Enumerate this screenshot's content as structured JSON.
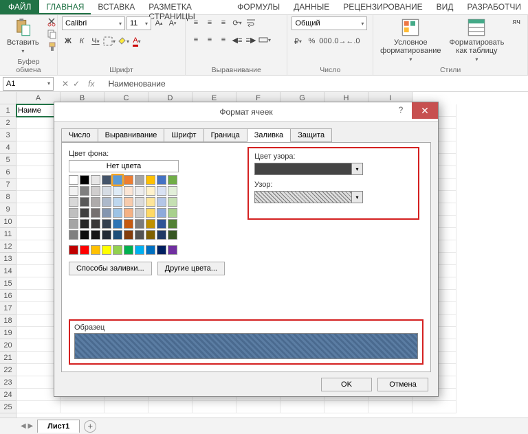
{
  "tabs": {
    "file": "ФАЙЛ",
    "items": [
      "ГЛАВНАЯ",
      "ВСТАВКА",
      "РАЗМЕТКА СТРАНИЦЫ",
      "ФОРМУЛЫ",
      "ДАННЫЕ",
      "РЕЦЕНЗИРОВАНИЕ",
      "ВИД",
      "РАЗРАБОТЧИ"
    ],
    "active": 0
  },
  "ribbon": {
    "clipboard": {
      "paste": "Вставить",
      "label": "Буфер обмена"
    },
    "font": {
      "name": "Calibri",
      "size": "11",
      "label": "Шрифт"
    },
    "align": {
      "label": "Выравнивание"
    },
    "number": {
      "format": "Общий",
      "label": "Число"
    },
    "styles": {
      "cond": "Условное\nформатирование",
      "table": "Форматировать\nкак таблицу",
      "cell": "яч",
      "label": "Стили"
    }
  },
  "formula": {
    "name_box": "A1",
    "cancel": "✕",
    "ok": "✓",
    "fx": "fx",
    "value": "Наименование"
  },
  "grid": {
    "cols": [
      "A",
      "B",
      "C",
      "D",
      "E",
      "F",
      "G",
      "H",
      "I"
    ],
    "rows": 25,
    "a1": "Наиме"
  },
  "sheets": {
    "active": "Лист1"
  },
  "dialog": {
    "title": "Формат ячеек",
    "tabs": [
      "Число",
      "Выравнивание",
      "Шрифт",
      "Граница",
      "Заливка",
      "Защита"
    ],
    "active_tab": 4,
    "bg_label": "Цвет фона:",
    "no_color": "Нет цвета",
    "fill_methods": "Способы заливки...",
    "other_colors": "Другие цвета...",
    "pattern_color_label": "Цвет узора:",
    "pattern_label": "Узор:",
    "sample_label": "Образец",
    "ok": "OK",
    "cancel": "Отмена",
    "theme_colors": [
      [
        "#ffffff",
        "#000000",
        "#e7e6e6",
        "#44546a",
        "#5b9bd5",
        "#ed7d31",
        "#a5a5a5",
        "#ffc000",
        "#4472c4",
        "#70ad47"
      ],
      [
        "#f2f2f2",
        "#7f7f7f",
        "#d0cece",
        "#d6dce4",
        "#deebf6",
        "#fbe5d5",
        "#ededed",
        "#fff2cc",
        "#d9e2f3",
        "#e2efd9"
      ],
      [
        "#d8d8d8",
        "#595959",
        "#aeabab",
        "#adb9ca",
        "#bdd7ee",
        "#f7cbac",
        "#dbdbdb",
        "#fee599",
        "#b4c6e7",
        "#c5e0b3"
      ],
      [
        "#bfbfbf",
        "#3f3f3f",
        "#757070",
        "#8496b0",
        "#9cc3e5",
        "#f4b183",
        "#c9c9c9",
        "#ffd965",
        "#8eaadb",
        "#a8d08d"
      ],
      [
        "#a5a5a5",
        "#262626",
        "#3a3838",
        "#323f4f",
        "#2e75b5",
        "#c55a11",
        "#7b7b7b",
        "#bf9000",
        "#2f5496",
        "#538135"
      ],
      [
        "#7f7f7f",
        "#0c0c0c",
        "#171616",
        "#222a35",
        "#1e4e79",
        "#833c0b",
        "#525252",
        "#7f6000",
        "#1f3864",
        "#375623"
      ]
    ],
    "standard_colors": [
      "#c00000",
      "#ff0000",
      "#ffc000",
      "#ffff00",
      "#92d050",
      "#00b050",
      "#00b0f0",
      "#0070c0",
      "#002060",
      "#7030a0"
    ]
  }
}
